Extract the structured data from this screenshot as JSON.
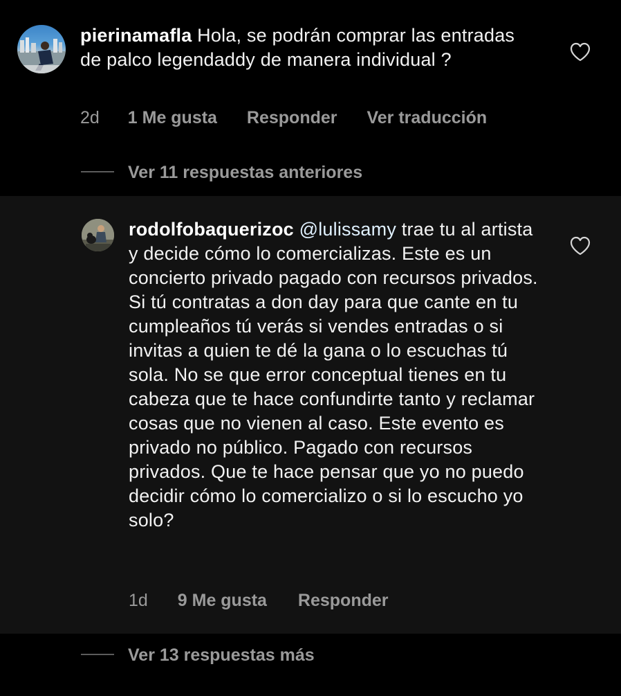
{
  "comments": [
    {
      "username": "pierinamafla",
      "mention": "",
      "text": "Hola, se podrán comprar las entradas de palco legendaddy de manera individual ?",
      "time": "2d",
      "likes": "1 Me gusta",
      "reply_label": "Responder",
      "translate_label": "Ver traducción",
      "heart_icon": "heart-outline-icon"
    },
    {
      "username": "rodolfobaquerizoc",
      "mention": "@lulissamy",
      "text": "trae tu al artista y decide cómo lo comercializas. Este es un concierto privado pagado con recursos privados. Si tú contratas a don day para que cante en tu cumpleaños  tú verás si vendes entradas o si invitas a quien te dé la gana o lo escuchas tú sola. No se que error conceptual tienes en tu cabeza que te hace confundirte tanto y reclamar cosas que no vienen al caso. Este evento es privado no público. Pagado con recursos privados. Que te hace pensar que yo no puedo decidir cómo lo comercializo o si lo escucho yo solo?",
      "time": "1d",
      "likes": "9 Me gusta",
      "reply_label": "Responder",
      "heart_icon": "heart-outline-icon"
    }
  ],
  "view_previous_replies": "Ver 11 respuestas anteriores",
  "view_more_replies": "Ver 13 respuestas más",
  "colors": {
    "background": "#000000",
    "highlight_background": "#121212",
    "text": "#f2f2f2",
    "meta": "#9a9a9a",
    "mention": "#e0f1ff"
  }
}
